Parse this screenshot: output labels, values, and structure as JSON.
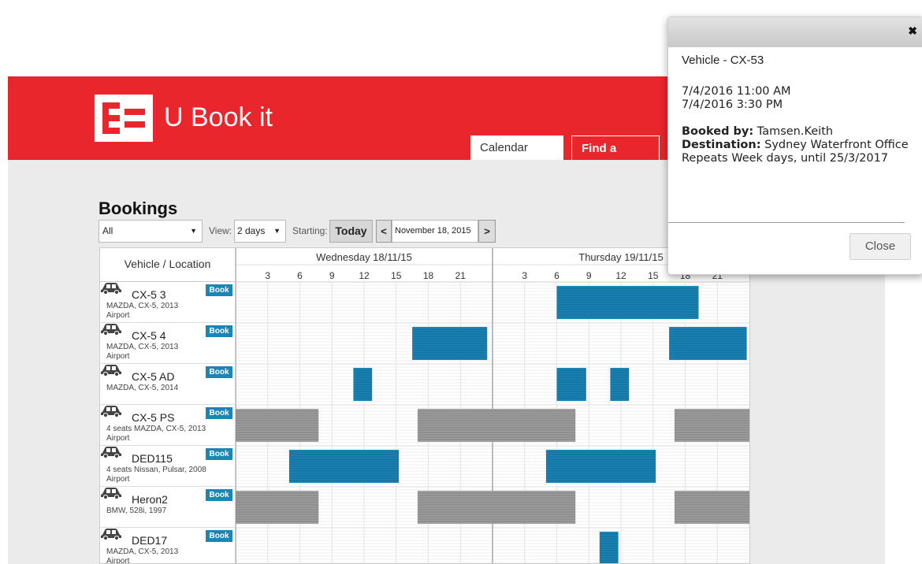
{
  "app": {
    "brand": "U Book it",
    "tabs": [
      "Calendar view",
      "Find a vehicle"
    ]
  },
  "page": {
    "title": "Bookings",
    "filter_value": "All",
    "view_label": "View:",
    "view_value": "2 days",
    "starting_label": "Starting:",
    "today_label": "Today",
    "prev_label": "<",
    "next_label": ">",
    "start_date": "November 18, 2015"
  },
  "grid": {
    "vehicle_header": "Vehicle / Location",
    "book_label": "Book",
    "days": [
      {
        "label": "Wednesday 18/11/15",
        "hours": [
          "3",
          "6",
          "9",
          "12",
          "15",
          "18",
          "21"
        ]
      },
      {
        "label": "Thursday 19/11/15",
        "hours": [
          "3",
          "6",
          "9",
          "12",
          "15",
          "18",
          "21"
        ]
      }
    ],
    "vehicles": [
      {
        "name": "CX-5 3",
        "desc": "MAZDA, CX-5, 2013",
        "loc": "Airport",
        "bookings": [
          {
            "day": 1,
            "start": 6.0,
            "end": 19.25,
            "kind": "booked"
          }
        ]
      },
      {
        "name": "CX-5 4",
        "desc": "MAZDA, CX-5, 2013",
        "loc": "Airport",
        "bookings": [
          {
            "day": 0,
            "start": 16.5,
            "end": 23.5,
            "kind": "booked"
          },
          {
            "day": 1,
            "start": 16.5,
            "end": 23.75,
            "kind": "booked"
          }
        ]
      },
      {
        "name": "CX-5 AD",
        "desc": "MAZDA, CX-5, 2014",
        "loc": "",
        "bookings": [
          {
            "day": 0,
            "start": 11.0,
            "end": 12.75,
            "kind": "booked"
          },
          {
            "day": 1,
            "start": 6.0,
            "end": 8.75,
            "kind": "booked"
          },
          {
            "day": 1,
            "start": 11.0,
            "end": 12.75,
            "kind": "booked"
          }
        ]
      },
      {
        "name": "CX-5 PS",
        "desc": "4 seats MAZDA, CX-5, 2013",
        "loc": "Airport",
        "bookings": [
          {
            "day": 0,
            "start": 0,
            "end": 7.75,
            "kind": "unavailable"
          },
          {
            "day": 0,
            "start": 17.0,
            "end": 24,
            "kind": "unavailable"
          },
          {
            "day": 1,
            "start": 0,
            "end": 7.75,
            "kind": "unavailable"
          },
          {
            "day": 1,
            "start": 17.0,
            "end": 24,
            "kind": "unavailable"
          }
        ]
      },
      {
        "name": "DED115",
        "desc": "4 seats Nissan, Pulsar, 2008",
        "loc": "Airport",
        "bookings": [
          {
            "day": 0,
            "start": 5.0,
            "end": 15.25,
            "kind": "booked"
          },
          {
            "day": 1,
            "start": 5.0,
            "end": 15.25,
            "kind": "booked"
          }
        ]
      },
      {
        "name": "Heron2",
        "desc": "BMW, 528i, 1997",
        "loc": "",
        "bookings": [
          {
            "day": 0,
            "start": 0,
            "end": 7.75,
            "kind": "unavailable"
          },
          {
            "day": 0,
            "start": 17.0,
            "end": 24,
            "kind": "unavailable"
          },
          {
            "day": 1,
            "start": 0,
            "end": 7.75,
            "kind": "unavailable"
          },
          {
            "day": 1,
            "start": 17.0,
            "end": 24,
            "kind": "unavailable"
          }
        ]
      },
      {
        "name": "DED17",
        "desc": "MAZDA, CX-5, 2013",
        "loc": "Airport",
        "bookings": [
          {
            "day": 1,
            "start": 10.0,
            "end": 11.75,
            "kind": "booked"
          }
        ]
      }
    ]
  },
  "popup": {
    "title": "Vehicle - CX-53",
    "start": "7/4/2016 11:00 AM",
    "end": "7/4/2016 3:30 PM",
    "booked_by_label": "Booked by:",
    "booked_by": "Tamsen.Keith",
    "destination_label": "Destination:",
    "destination": "Sydney Waterfront Office",
    "repeats": "Repeats Week days, until 25/3/2017",
    "close_label": "Close",
    "x_label": "✖"
  },
  "colors": {
    "brand_red": "#e8262b",
    "booked": "#1a86b8",
    "unavailable": "#a0a0a0"
  }
}
